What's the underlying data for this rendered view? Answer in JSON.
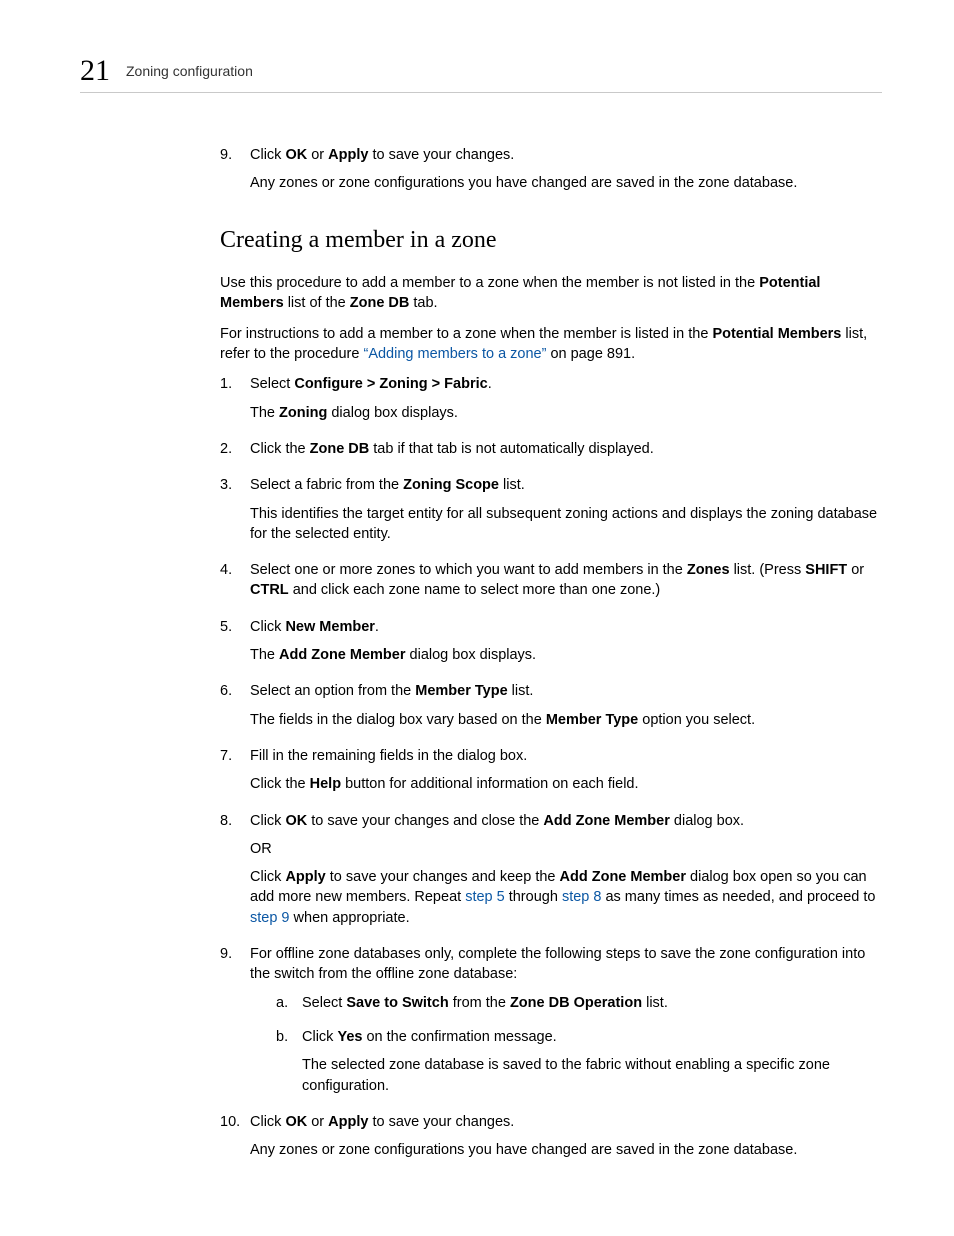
{
  "header": {
    "chapter_number": "21",
    "chapter_title": "Zoning configuration"
  },
  "pre_steps": [
    {
      "n": "9.",
      "paras": [
        {
          "runs": [
            {
              "t": "Click "
            },
            {
              "t": "OK",
              "b": true
            },
            {
              "t": " or "
            },
            {
              "t": "Apply",
              "b": true
            },
            {
              "t": " to save your changes."
            }
          ]
        },
        {
          "runs": [
            {
              "t": "Any zones or zone configurations you have changed are saved in the zone database."
            }
          ]
        }
      ]
    }
  ],
  "section_heading": "Creating a member in a zone",
  "intro": [
    {
      "runs": [
        {
          "t": "Use this procedure to add a member to a zone when the member is not listed in the "
        },
        {
          "t": "Potential Members",
          "b": true
        },
        {
          "t": " list of the "
        },
        {
          "t": "Zone DB",
          "b": true
        },
        {
          "t": " tab."
        }
      ]
    },
    {
      "runs": [
        {
          "t": "For instructions to add a member to a zone when the member is listed in the "
        },
        {
          "t": "Potential Members",
          "b": true
        },
        {
          "t": " list, refer to the procedure "
        },
        {
          "t": "“Adding members to a zone”",
          "link": true
        },
        {
          "t": " on page 891."
        }
      ]
    }
  ],
  "steps": [
    {
      "n": "1.",
      "paras": [
        {
          "runs": [
            {
              "t": "Select "
            },
            {
              "t": "Configure > Zoning > Fabric",
              "b": true
            },
            {
              "t": "."
            }
          ]
        },
        {
          "runs": [
            {
              "t": "The "
            },
            {
              "t": "Zoning",
              "b": true
            },
            {
              "t": " dialog box displays."
            }
          ]
        }
      ]
    },
    {
      "n": "2.",
      "paras": [
        {
          "runs": [
            {
              "t": "Click the "
            },
            {
              "t": "Zone DB",
              "b": true
            },
            {
              "t": " tab if that tab is not automatically displayed."
            }
          ]
        }
      ]
    },
    {
      "n": "3.",
      "paras": [
        {
          "runs": [
            {
              "t": "Select a fabric from the "
            },
            {
              "t": "Zoning Scope",
              "b": true
            },
            {
              "t": " list."
            }
          ]
        },
        {
          "runs": [
            {
              "t": "This identifies the target entity for all subsequent zoning actions and displays the zoning database for the selected entity."
            }
          ]
        }
      ]
    },
    {
      "n": "4.",
      "paras": [
        {
          "runs": [
            {
              "t": "Select one or more zones to which you want to add members in the "
            },
            {
              "t": "Zones",
              "b": true
            },
            {
              "t": " list. (Press "
            },
            {
              "t": "SHIFT",
              "b": true
            },
            {
              "t": " or "
            },
            {
              "t": "CTRL",
              "b": true
            },
            {
              "t": " and click each zone name to select more than one zone.)"
            }
          ]
        }
      ]
    },
    {
      "n": "5.",
      "paras": [
        {
          "runs": [
            {
              "t": "Click "
            },
            {
              "t": "New Member",
              "b": true
            },
            {
              "t": "."
            }
          ]
        },
        {
          "runs": [
            {
              "t": "The "
            },
            {
              "t": "Add Zone Member",
              "b": true
            },
            {
              "t": " dialog box displays."
            }
          ]
        }
      ]
    },
    {
      "n": "6.",
      "paras": [
        {
          "runs": [
            {
              "t": "Select an option from the "
            },
            {
              "t": "Member Type",
              "b": true
            },
            {
              "t": " list."
            }
          ]
        },
        {
          "runs": [
            {
              "t": "The fields in the dialog box vary based on the "
            },
            {
              "t": "Member Type",
              "b": true
            },
            {
              "t": " option you select."
            }
          ]
        }
      ]
    },
    {
      "n": "7.",
      "paras": [
        {
          "runs": [
            {
              "t": "Fill in the remaining fields in the dialog box."
            }
          ]
        },
        {
          "runs": [
            {
              "t": "Click the "
            },
            {
              "t": "Help",
              "b": true
            },
            {
              "t": " button for additional information on each field."
            }
          ]
        }
      ]
    },
    {
      "n": "8.",
      "paras": [
        {
          "runs": [
            {
              "t": "Click "
            },
            {
              "t": "OK",
              "b": true
            },
            {
              "t": " to save your changes and close the "
            },
            {
              "t": "Add Zone Member",
              "b": true
            },
            {
              "t": " dialog box."
            }
          ]
        },
        {
          "runs": [
            {
              "t": "OR"
            }
          ]
        },
        {
          "runs": [
            {
              "t": "Click "
            },
            {
              "t": "Apply",
              "b": true
            },
            {
              "t": " to save your changes and keep the "
            },
            {
              "t": "Add Zone Member",
              "b": true
            },
            {
              "t": " dialog box open so you can add more new members. Repeat "
            },
            {
              "t": "step 5",
              "link": true
            },
            {
              "t": " through "
            },
            {
              "t": "step 8",
              "link": true
            },
            {
              "t": " as many times as needed, and proceed to "
            },
            {
              "t": "step 9",
              "link": true
            },
            {
              "t": " when appropriate."
            }
          ]
        }
      ]
    },
    {
      "n": "9.",
      "paras": [
        {
          "runs": [
            {
              "t": "For offline zone databases only, complete the following steps to save the zone configuration into the switch from the offline zone database:"
            }
          ]
        }
      ],
      "sub": [
        {
          "n": "a.",
          "paras": [
            {
              "runs": [
                {
                  "t": "Select "
                },
                {
                  "t": "Save to Switch",
                  "b": true
                },
                {
                  "t": " from the "
                },
                {
                  "t": "Zone DB Operation",
                  "b": true
                },
                {
                  "t": " list."
                }
              ]
            }
          ]
        },
        {
          "n": "b.",
          "paras": [
            {
              "runs": [
                {
                  "t": "Click "
                },
                {
                  "t": "Yes",
                  "b": true
                },
                {
                  "t": " on the confirmation message."
                }
              ]
            },
            {
              "runs": [
                {
                  "t": "The selected zone database is saved to the fabric without enabling a specific zone configuration."
                }
              ]
            }
          ]
        }
      ]
    },
    {
      "n": "10.",
      "paras": [
        {
          "runs": [
            {
              "t": "Click "
            },
            {
              "t": "OK",
              "b": true
            },
            {
              "t": " or "
            },
            {
              "t": "Apply",
              "b": true
            },
            {
              "t": " to save your changes."
            }
          ]
        },
        {
          "runs": [
            {
              "t": "Any zones or zone configurations you have changed are saved in the zone database."
            }
          ]
        }
      ]
    }
  ]
}
